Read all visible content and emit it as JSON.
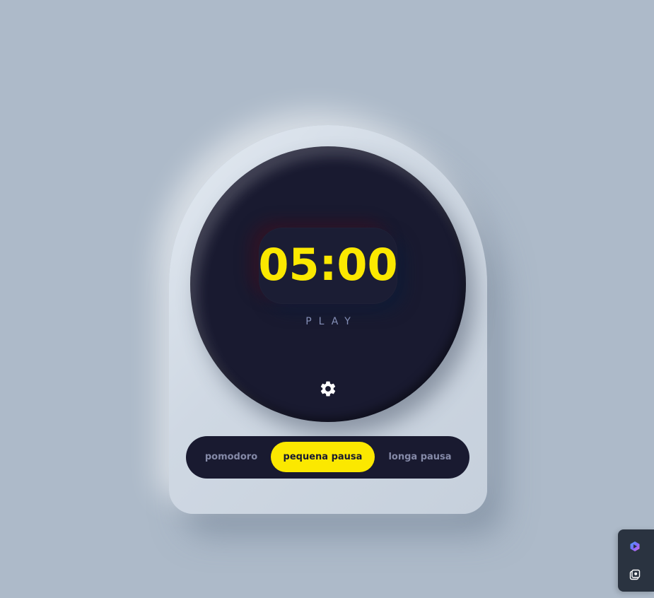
{
  "timer": {
    "time": "05:00",
    "action_label": "PLAY"
  },
  "controls": {
    "settings_icon": "gear-icon"
  },
  "modes": {
    "items": [
      {
        "label": "pomodoro",
        "active": false
      },
      {
        "label": "pequena pausa",
        "active": true
      },
      {
        "label": "longa pausa",
        "active": false
      }
    ]
  },
  "side_dock": {
    "items": [
      {
        "icon": "copilot-icon"
      },
      {
        "icon": "screenshot-icon"
      }
    ]
  },
  "colors": {
    "background": "#adbac9",
    "dial": "#191a30",
    "accent": "#fbe800",
    "muted_text": "#858aa8"
  }
}
